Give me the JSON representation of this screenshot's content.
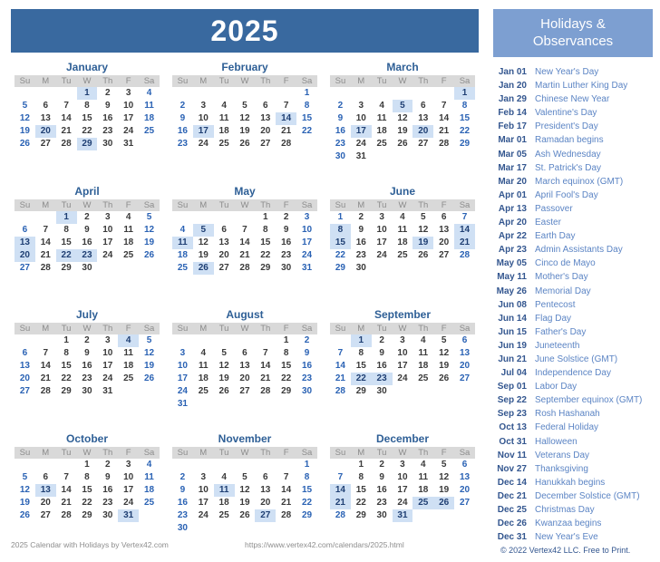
{
  "year_banner": {
    "title": "2025"
  },
  "weekday_headers": [
    "Su",
    "M",
    "Tu",
    "W",
    "Th",
    "F",
    "Sa"
  ],
  "months": [
    {
      "name": "January",
      "start": 3,
      "days": 31,
      "highlights": [
        1,
        20,
        29
      ]
    },
    {
      "name": "February",
      "start": 6,
      "days": 28,
      "highlights": [
        14,
        17
      ]
    },
    {
      "name": "March",
      "start": 6,
      "days": 31,
      "highlights": [
        1,
        5,
        17,
        20
      ]
    },
    {
      "name": "April",
      "start": 2,
      "days": 30,
      "highlights": [
        1,
        13,
        20,
        22,
        23
      ]
    },
    {
      "name": "May",
      "start": 4,
      "days": 31,
      "highlights": [
        5,
        11,
        26
      ]
    },
    {
      "name": "June",
      "start": 0,
      "days": 30,
      "highlights": [
        8,
        14,
        15,
        19,
        21
      ]
    },
    {
      "name": "July",
      "start": 2,
      "days": 31,
      "highlights": [
        4
      ]
    },
    {
      "name": "August",
      "start": 5,
      "days": 31,
      "highlights": []
    },
    {
      "name": "September",
      "start": 1,
      "days": 30,
      "highlights": [
        1,
        22,
        23
      ]
    },
    {
      "name": "October",
      "start": 3,
      "days": 31,
      "highlights": [
        13,
        31
      ]
    },
    {
      "name": "November",
      "start": 6,
      "days": 30,
      "highlights": [
        11,
        27
      ]
    },
    {
      "name": "December",
      "start": 1,
      "days": 31,
      "highlights": [
        14,
        21,
        25,
        26,
        31
      ]
    }
  ],
  "holidays_panel": {
    "title_line1": "Holidays &",
    "title_line2": "Observances",
    "items": [
      {
        "date": "Jan 01",
        "name": "New Year's Day"
      },
      {
        "date": "Jan 20",
        "name": "Martin Luther King Day"
      },
      {
        "date": "Jan 29",
        "name": "Chinese New Year"
      },
      {
        "date": "Feb 14",
        "name": "Valentine's Day"
      },
      {
        "date": "Feb 17",
        "name": "President's Day"
      },
      {
        "date": "Mar 01",
        "name": "Ramadan begins"
      },
      {
        "date": "Mar 05",
        "name": "Ash Wednesday"
      },
      {
        "date": "Mar 17",
        "name": "St. Patrick's Day"
      },
      {
        "date": "Mar 20",
        "name": "March equinox (GMT)"
      },
      {
        "date": "Apr 01",
        "name": "April Fool's Day"
      },
      {
        "date": "Apr 13",
        "name": "Passover"
      },
      {
        "date": "Apr 20",
        "name": "Easter"
      },
      {
        "date": "Apr 22",
        "name": "Earth Day"
      },
      {
        "date": "Apr 23",
        "name": "Admin Assistants Day"
      },
      {
        "date": "May 05",
        "name": "Cinco de Mayo"
      },
      {
        "date": "May 11",
        "name": "Mother's Day"
      },
      {
        "date": "May 26",
        "name": "Memorial Day"
      },
      {
        "date": "Jun 08",
        "name": "Pentecost"
      },
      {
        "date": "Jun 14",
        "name": "Flag Day"
      },
      {
        "date": "Jun 15",
        "name": "Father's Day"
      },
      {
        "date": "Jun 19",
        "name": "Juneteenth"
      },
      {
        "date": "Jun 21",
        "name": "June Solstice (GMT)"
      },
      {
        "date": "Jul 04",
        "name": "Independence Day"
      },
      {
        "date": "Sep 01",
        "name": "Labor Day"
      },
      {
        "date": "Sep 22",
        "name": "September equinox (GMT)"
      },
      {
        "date": "Sep 23",
        "name": "Rosh Hashanah"
      },
      {
        "date": "Oct 13",
        "name": "Federal Holiday"
      },
      {
        "date": "Oct 31",
        "name": "Halloween"
      },
      {
        "date": "Nov 11",
        "name": "Veterans Day"
      },
      {
        "date": "Nov 27",
        "name": "Thanksgiving"
      },
      {
        "date": "Dec 14",
        "name": "Hanukkah begins"
      },
      {
        "date": "Dec 21",
        "name": "December Solstice (GMT)"
      },
      {
        "date": "Dec 25",
        "name": "Christmas Day"
      },
      {
        "date": "Dec 26",
        "name": "Kwanzaa begins"
      },
      {
        "date": "Dec 31",
        "name": "New Year's Eve"
      }
    ],
    "copyright": "© 2022 Vertex42 LLC. Free to Print."
  },
  "footer": {
    "left": "2025 Calendar with Holidays by Vertex42.com",
    "right": "https://www.vertex42.com/calendars/2025.html"
  },
  "colors": {
    "year_banner_bg": "#39699f",
    "holidays_banner_bg": "#7d9fd1",
    "month_title": "#2e5f96",
    "weekend_text": "#2a62b4",
    "weekday_text": "#3a3a3a",
    "highlight_bg": "#cfe0f4",
    "dow_header_bg": "#d9d9d9"
  }
}
